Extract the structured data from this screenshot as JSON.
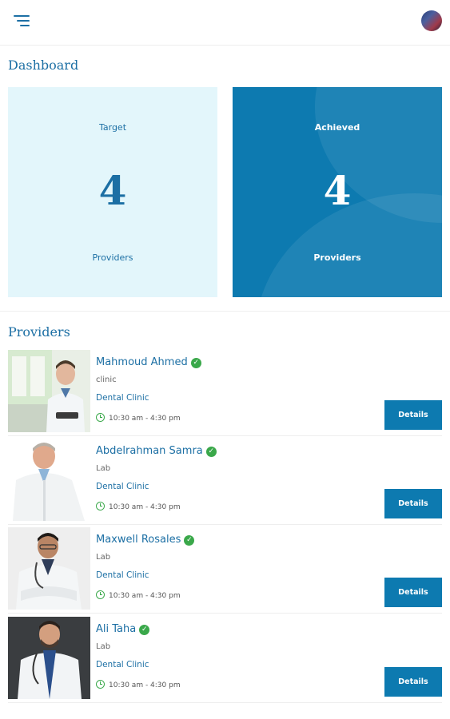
{
  "header": {
    "menu_icon": "menu-icon",
    "avatar_icon": "user-avatar"
  },
  "dashboard": {
    "title": "Dashboard",
    "target": {
      "label": "Target",
      "value": "4",
      "unit": "Providers",
      "color": "#e3f6fb"
    },
    "achieved": {
      "label": "Achieved",
      "value": "4",
      "unit": "Providers",
      "color": "#0d7ab0"
    }
  },
  "providers": {
    "title": "Providers",
    "items": [
      {
        "name": "Mahmoud Ahmed",
        "type": "clinic",
        "clinic": "Dental Clinic",
        "hours": "10:30 am - 4:30 pm",
        "button": "Details"
      },
      {
        "name": "Abdelrahman Samra",
        "type": "Lab",
        "clinic": "Dental Clinic",
        "hours": "10:30 am - 4:30 pm",
        "button": "Details"
      },
      {
        "name": "Maxwell Rosales",
        "type": "Lab",
        "clinic": "Dental Clinic",
        "hours": "10:30 am - 4:30 pm",
        "button": "Details"
      },
      {
        "name": "Ali Taha",
        "type": "Lab",
        "clinic": "Dental Clinic",
        "hours": "10:30 am - 4:30 pm",
        "button": "Details"
      }
    ]
  },
  "colors": {
    "accent": "#1c6fa4",
    "button": "#0d7ab0",
    "verified": "#3aa84a"
  }
}
